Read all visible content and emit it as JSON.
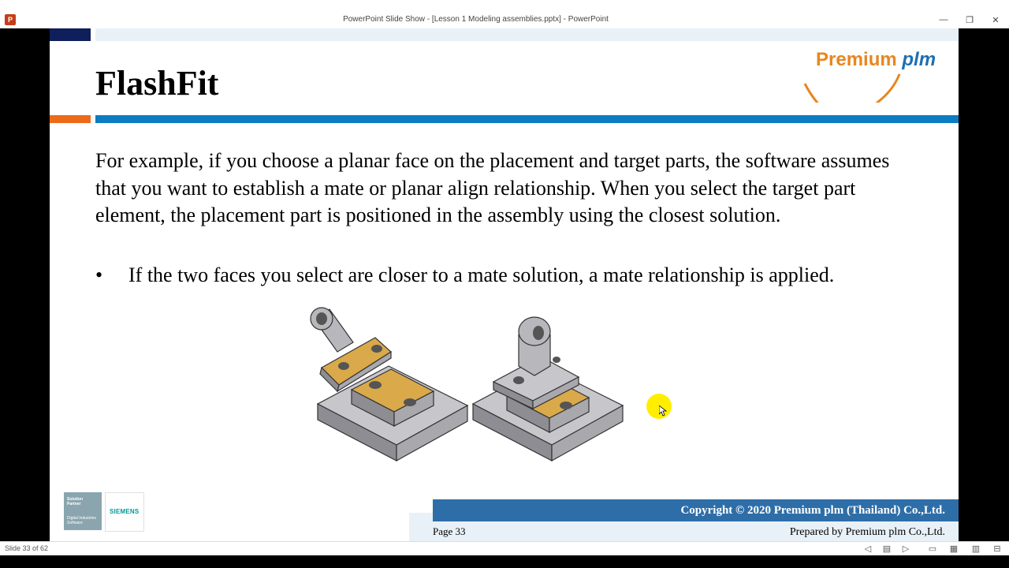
{
  "window": {
    "title": "PowerPoint Slide Show - [Lesson 1 Modeling assemblies.pptx] - PowerPoint",
    "controls": {
      "minimize": "—",
      "restore": "❐",
      "close": "✕"
    }
  },
  "slide": {
    "title": "FlashFit",
    "logo": {
      "part1": "Premium",
      "part2": "plm"
    },
    "body": "For example, if you choose a planar face on the placement and target parts, the software assumes that you want to establish a mate or planar align relationship. When you select the target part element, the placement part is positioned in the assembly using the closest solution.",
    "bullet_symbol": "•",
    "bullet": "If the two faces you select are closer to a mate solution, a mate relationship is applied.",
    "partner_badge": {
      "line1": "Solution",
      "line2": "Partner",
      "line3": "Digital Industries",
      "line4": "Software"
    },
    "siemens": "SIEMENS",
    "copyright": "Copyright © 2020 Premium plm (Thailand) Co.,Ltd.",
    "page": "Page 33",
    "prepared_by": "Prepared by Premium plm Co.,Ltd."
  },
  "status": {
    "slide_count": "Slide 33 of 62"
  },
  "colors": {
    "navy": "#0f1f5c",
    "orange": "#ec6a1a",
    "blue": "#0d7cc1",
    "footer_blue": "#2e6ea8",
    "part_gold": "#d9a94a",
    "part_gray": "#b8b8bc"
  }
}
